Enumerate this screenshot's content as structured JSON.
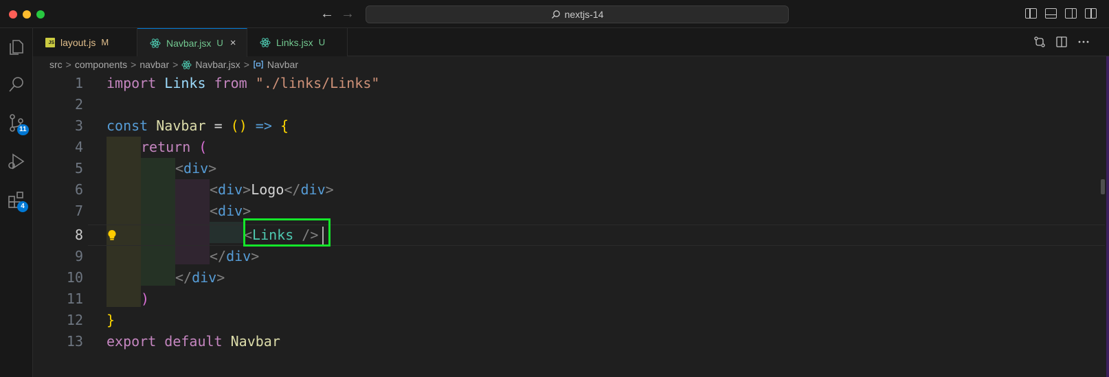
{
  "window": {
    "command_center": "nextjs-14",
    "back_icon": "arrow-left-icon",
    "forward_icon": "arrow-right-icon"
  },
  "activity_bar": {
    "items": [
      {
        "name": "explorer-icon"
      },
      {
        "name": "search-icon"
      },
      {
        "name": "source-control-icon",
        "badge": "11"
      },
      {
        "name": "run-debug-icon"
      },
      {
        "name": "extensions-icon",
        "badge": "4"
      }
    ]
  },
  "tabs": [
    {
      "label": "layout.js",
      "status": "M",
      "icon": "js-file-icon",
      "active": false
    },
    {
      "label": "Navbar.jsx",
      "status": "U",
      "icon": "react-icon",
      "active": true,
      "close": "×"
    },
    {
      "label": "Links.jsx",
      "status": "U",
      "icon": "react-icon",
      "active": false
    }
  ],
  "breadcrumb": {
    "items": [
      "src",
      "components",
      "navbar",
      "Navbar.jsx",
      "Navbar"
    ],
    "separator": ">"
  },
  "editor": {
    "active_line": 8,
    "line_numbers": [
      "1",
      "2",
      "3",
      "4",
      "5",
      "6",
      "7",
      "8",
      "9",
      "10",
      "11",
      "12",
      "13"
    ],
    "code": {
      "l1": {
        "kw": "import",
        "ident": "Links",
        "from": "from",
        "str": "\"./links/Links\""
      },
      "l3": {
        "const": "const",
        "name": "Navbar",
        "eq": "=",
        "parens": "()",
        "arrow": "=>",
        "brace": "{"
      },
      "l4": {
        "ret": "return",
        "paren": "("
      },
      "l5": {
        "open": "<",
        "tag": "div",
        "close": ">"
      },
      "l6": {
        "open": "<",
        "tag": "div",
        "close": ">",
        "text": "Logo",
        "end_open": "</",
        "end_tag": "div",
        "end_close": ">"
      },
      "l7": {
        "open": "<",
        "tag": "div",
        "close": ">"
      },
      "l8": {
        "open": "<",
        "comp": "Links",
        "selfclose": " />"
      },
      "l9": {
        "end_open": "</",
        "tag": "div",
        "end_close": ">"
      },
      "l10": {
        "end_open": "</",
        "tag": "div",
        "end_close": ">"
      },
      "l11": {
        "paren": ")"
      },
      "l12": {
        "brace": "}"
      },
      "l13": {
        "export": "export",
        "default": "default",
        "name": "Navbar"
      }
    }
  },
  "colors": {
    "highlight_box": "#14e62a",
    "accent": "#0078d4"
  }
}
